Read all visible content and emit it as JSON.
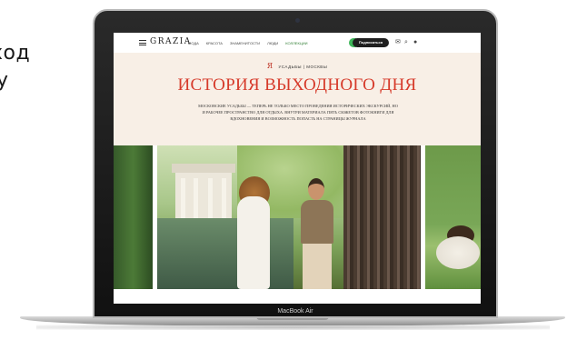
{
  "side_text": {
    "line1": "ход",
    "line2": "у"
  },
  "laptop": {
    "model_label": "MacBook Air"
  },
  "site": {
    "logo": "GRAZIA",
    "menu": [
      "Мода",
      "Красота",
      "Знаменитости",
      "Люди",
      "Коллекции"
    ],
    "cta_label": "Подписаться",
    "kicker": "УСАДЬБЫ | МОСКВЫ",
    "headline": "ИСТОРИЯ ВЫХОДНОГО ДНЯ",
    "lead": "Московские усадьбы — теперь не только место проведения исторических экскурсий, но и рабочее пространство для отдыха. Внутри материала пять сюжетов фотокниги для вдохновения и возможность попасть на страницы журнала"
  },
  "colors": {
    "headline": "#d63a2a",
    "hero_bg": "#f8efe6",
    "cta_accent": "#3fb65a"
  }
}
